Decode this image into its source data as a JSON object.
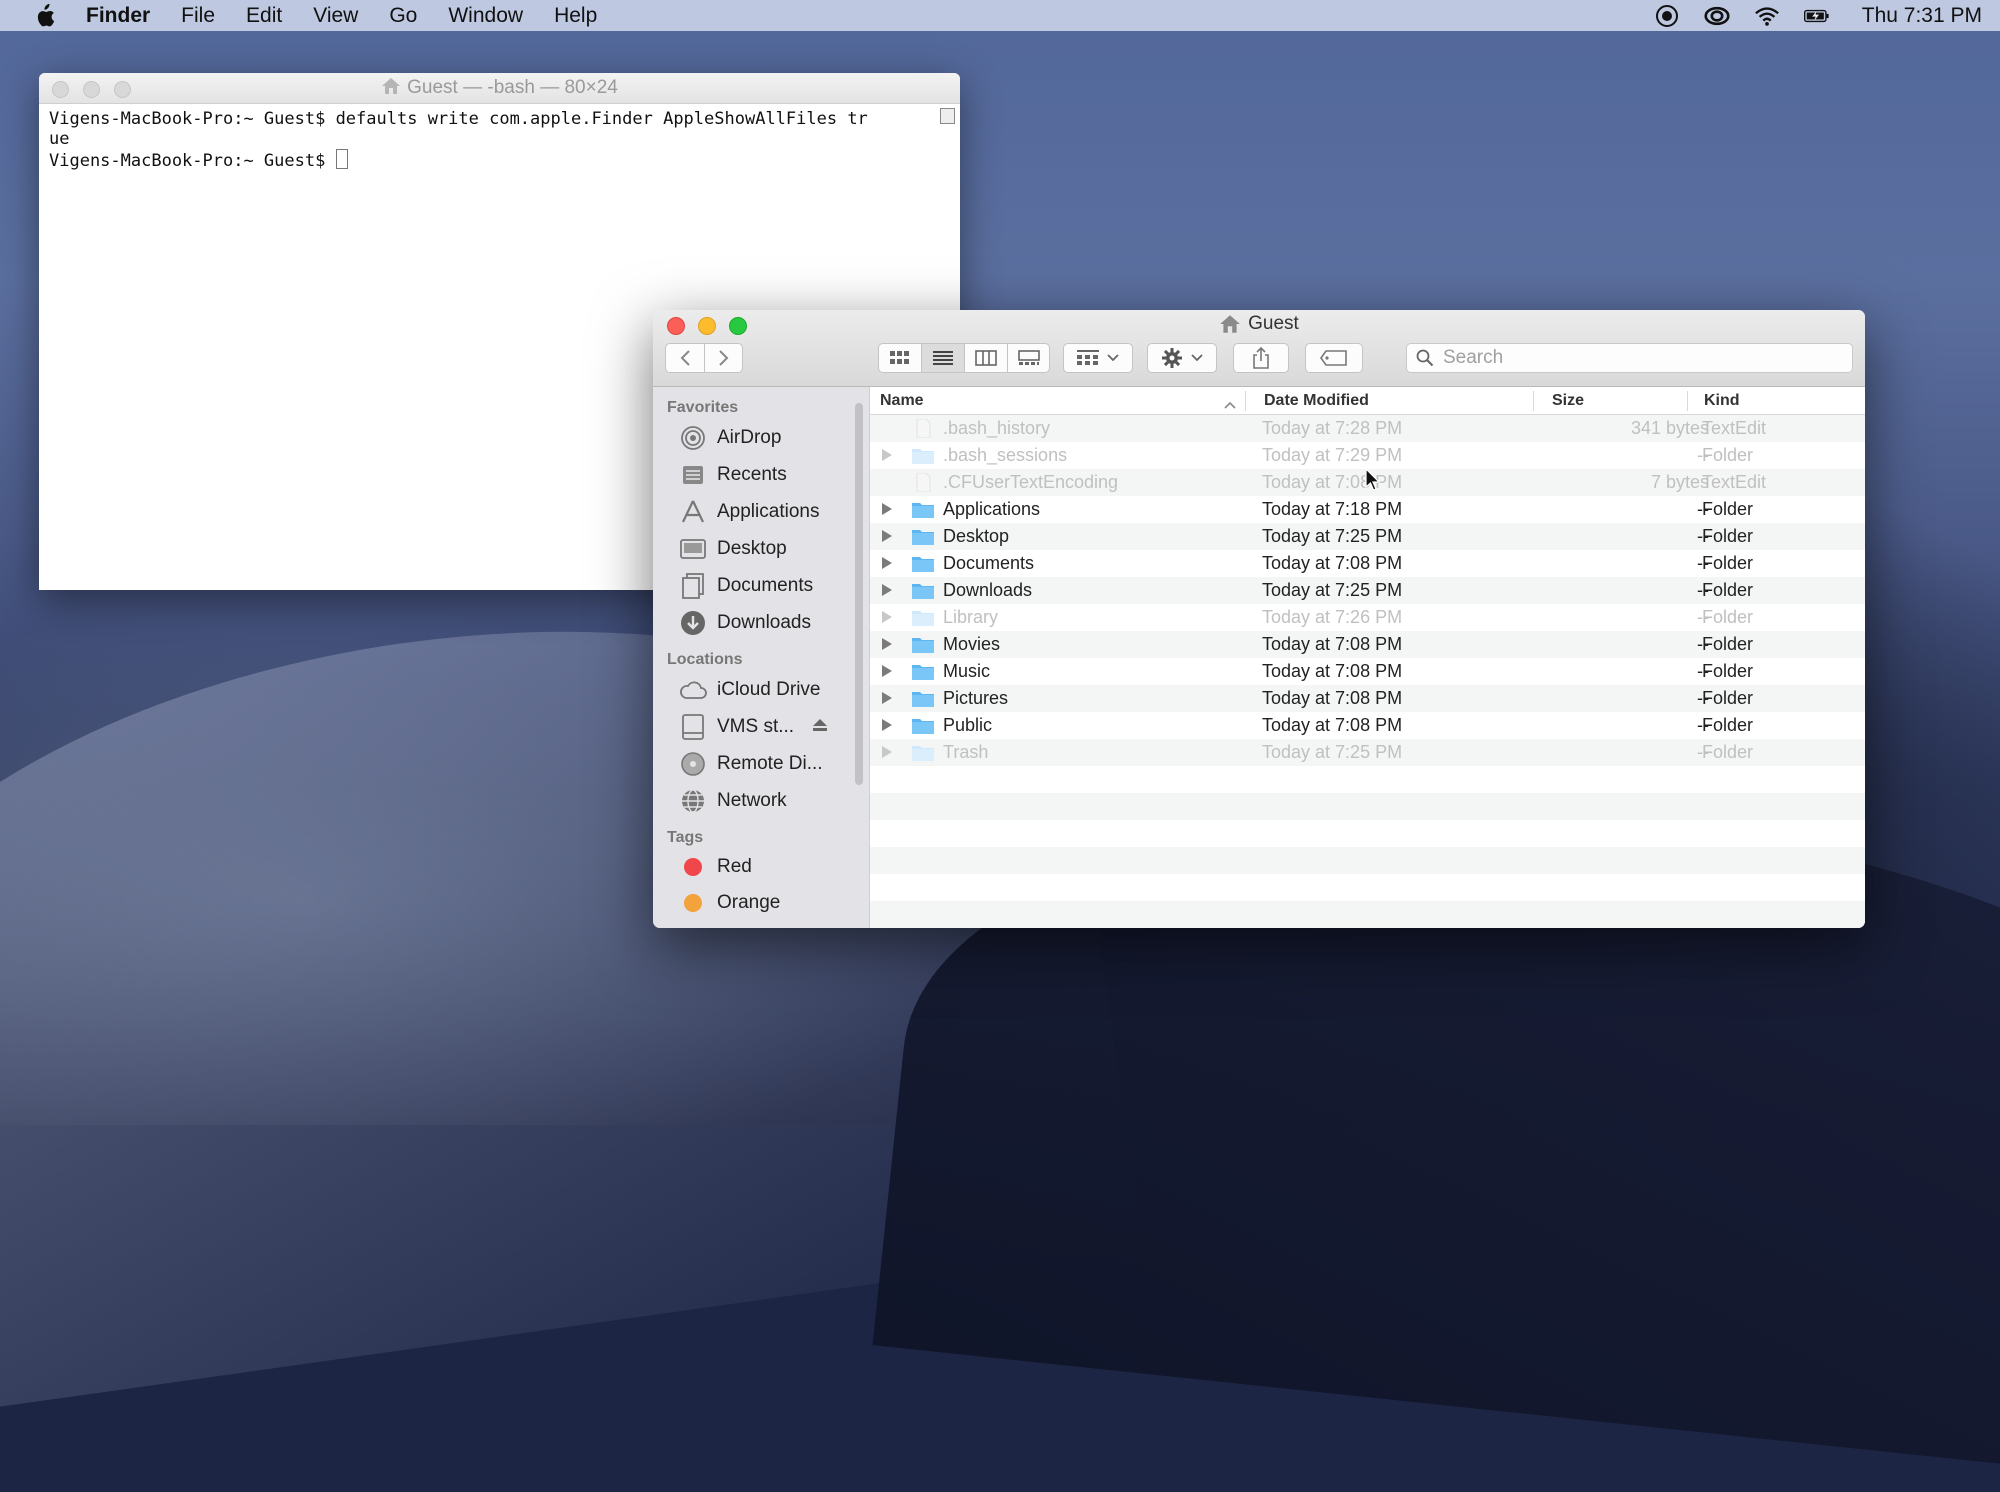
{
  "menubar": {
    "app_name": "Finder",
    "menus": [
      "File",
      "Edit",
      "View",
      "Go",
      "Window",
      "Help"
    ],
    "clock": "Thu 7:31 PM"
  },
  "terminal": {
    "title": "Guest — -bash — 80×24",
    "lines": [
      "Vigens-MacBook-Pro:~ Guest$ defaults write com.apple.Finder AppleShowAllFiles tr",
      "ue",
      "Vigens-MacBook-Pro:~ Guest$ "
    ]
  },
  "finder": {
    "title": "Guest",
    "search_placeholder": "Search",
    "sidebar": {
      "favorites_label": "Favorites",
      "favorites": [
        {
          "label": "AirDrop",
          "icon": "airdrop-icon"
        },
        {
          "label": "Recents",
          "icon": "recents-icon"
        },
        {
          "label": "Applications",
          "icon": "applications-icon"
        },
        {
          "label": "Desktop",
          "icon": "desktop-icon"
        },
        {
          "label": "Documents",
          "icon": "documents-icon"
        },
        {
          "label": "Downloads",
          "icon": "downloads-icon"
        }
      ],
      "locations_label": "Locations",
      "locations": [
        {
          "label": "iCloud Drive",
          "icon": "cloud-icon"
        },
        {
          "label": "VMS st...",
          "icon": "drive-icon"
        },
        {
          "label": "Remote Di...",
          "icon": "disc-icon"
        },
        {
          "label": "Network",
          "icon": "globe-icon"
        }
      ],
      "tags_label": "Tags",
      "tags": [
        {
          "label": "Red",
          "color": "#f0484a"
        },
        {
          "label": "Orange",
          "color": "#f4a23c"
        }
      ]
    },
    "columns": {
      "name": "Name",
      "date": "Date Modified",
      "size": "Size",
      "kind": "Kind"
    },
    "files": [
      {
        "name": ".bash_history",
        "date": "Today at 7:28 PM",
        "size": "341 bytes",
        "kind": "TextEdit",
        "folder": false,
        "hidden": true
      },
      {
        "name": ".bash_sessions",
        "date": "Today at 7:29 PM",
        "size": "--",
        "kind": "Folder",
        "folder": true,
        "hidden": true
      },
      {
        "name": ".CFUserTextEncoding",
        "date": "Today at 7:08 PM",
        "size": "7 bytes",
        "kind": "TextEdit",
        "folder": false,
        "hidden": true
      },
      {
        "name": "Applications",
        "date": "Today at 7:18 PM",
        "size": "--",
        "kind": "Folder",
        "folder": true,
        "hidden": false
      },
      {
        "name": "Desktop",
        "date": "Today at 7:25 PM",
        "size": "--",
        "kind": "Folder",
        "folder": true,
        "hidden": false
      },
      {
        "name": "Documents",
        "date": "Today at 7:08 PM",
        "size": "--",
        "kind": "Folder",
        "folder": true,
        "hidden": false
      },
      {
        "name": "Downloads",
        "date": "Today at 7:25 PM",
        "size": "--",
        "kind": "Folder",
        "folder": true,
        "hidden": false
      },
      {
        "name": "Library",
        "date": "Today at 7:26 PM",
        "size": "--",
        "kind": "Folder",
        "folder": true,
        "hidden": true
      },
      {
        "name": "Movies",
        "date": "Today at 7:08 PM",
        "size": "--",
        "kind": "Folder",
        "folder": true,
        "hidden": false
      },
      {
        "name": "Music",
        "date": "Today at 7:08 PM",
        "size": "--",
        "kind": "Folder",
        "folder": true,
        "hidden": false
      },
      {
        "name": "Pictures",
        "date": "Today at 7:08 PM",
        "size": "--",
        "kind": "Folder",
        "folder": true,
        "hidden": false
      },
      {
        "name": "Public",
        "date": "Today at 7:08 PM",
        "size": "--",
        "kind": "Folder",
        "folder": true,
        "hidden": false
      },
      {
        "name": "Trash",
        "date": "Today at 7:25 PM",
        "size": "--",
        "kind": "Folder",
        "folder": true,
        "hidden": true
      }
    ]
  }
}
